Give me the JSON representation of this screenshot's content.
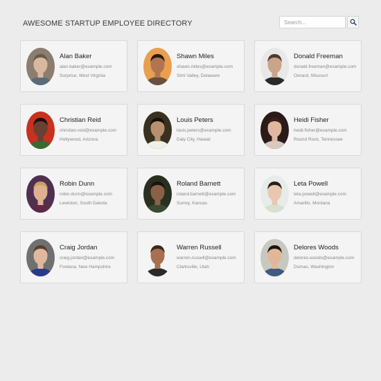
{
  "header": {
    "title": "AWESOME STARTUP EMPLOYEE DIRECTORY"
  },
  "search": {
    "placeholder": "Search...",
    "value": "",
    "button_icon": "search-icon"
  },
  "employees": [
    {
      "name": "Alan Baker",
      "email": "alan.baker@example.com",
      "location": "Surprise, West Virginia",
      "photo": {
        "bg": "#8b7d70",
        "skin": "#d9b8a0",
        "hair": "#6a5a4a",
        "shirt": "#5b6a78"
      }
    },
    {
      "name": "Shawn Miles",
      "email": "shawn.miles@example.com",
      "location": "Simi Valley, Delaware",
      "photo": {
        "bg": "#e8a050",
        "skin": "#b07550",
        "hair": "#2a1a10",
        "shirt": "#6a5040"
      }
    },
    {
      "name": "Donald Freeman",
      "email": "donald.freeman@example.com",
      "location": "Oxnard, Missouri",
      "photo": {
        "bg": "#e8e8e8",
        "skin": "#c9a48a",
        "hair": "#4a3a30",
        "shirt": "#2a2a2a"
      }
    },
    {
      "name": "Christian Reid",
      "email": "christian.reid@example.com",
      "location": "Hollywood, Arizona",
      "photo": {
        "bg": "#c83020",
        "skin": "#6b4030",
        "hair": "#1a1010",
        "shirt": "#3a6a30"
      }
    },
    {
      "name": "Louis Peters",
      "email": "louis.peters@example.com",
      "location": "Daly City, Hawaii",
      "photo": {
        "bg": "#3a3020",
        "skin": "#b89070",
        "hair": "#15100a",
        "shirt": "#f0f0ea"
      }
    },
    {
      "name": "Heidi Fisher",
      "email": "heidi.fisher@example.com",
      "location": "Round Rock, Tennessee",
      "photo": {
        "bg": "#2a1a18",
        "skin": "#e0b8a0",
        "hair": "#3a2018",
        "shirt": "#d8c8c0"
      }
    },
    {
      "name": "Robin Dunn",
      "email": "robin.dunn@example.com",
      "location": "Lewiston, South Dakota",
      "photo": {
        "bg": "#503050",
        "skin": "#e0b090",
        "hair": "#c8a060",
        "shirt": "#602848"
      }
    },
    {
      "name": "Roland Barnett",
      "email": "roland.barnett@example.com",
      "location": "Surrey, Kansas",
      "photo": {
        "bg": "#2a3020",
        "skin": "#8a6048",
        "hair": "#1a1410",
        "shirt": "#3a4a30"
      }
    },
    {
      "name": "Leta Powell",
      "email": "leta.powell@example.com",
      "location": "Amarillo, Montana",
      "photo": {
        "bg": "#e8ece8",
        "skin": "#e8c8b0",
        "hair": "#2a2018",
        "shirt": "#d8e0d0"
      }
    },
    {
      "name": "Craig Jordan",
      "email": "craig.jordan@example.com",
      "location": "Fontana, New Hampshire",
      "photo": {
        "bg": "#707070",
        "skin": "#e0b8a0",
        "hair": "#5a4030",
        "shirt": "#2a3a8a"
      }
    },
    {
      "name": "Warren Russell",
      "email": "warren.russell@example.com",
      "location": "Clarksville, Utah",
      "photo": {
        "bg": "#f4f4f4",
        "skin": "#a87050",
        "hair": "#3a2a20",
        "shirt": "#2a2a2a"
      }
    },
    {
      "name": "Delores Woods",
      "email": "delores.woods@example.com",
      "location": "Dumas, Washington",
      "photo": {
        "bg": "#c8c8c0",
        "skin": "#e0b898",
        "hair": "#1a1410",
        "shirt": "#405a80"
      }
    }
  ]
}
